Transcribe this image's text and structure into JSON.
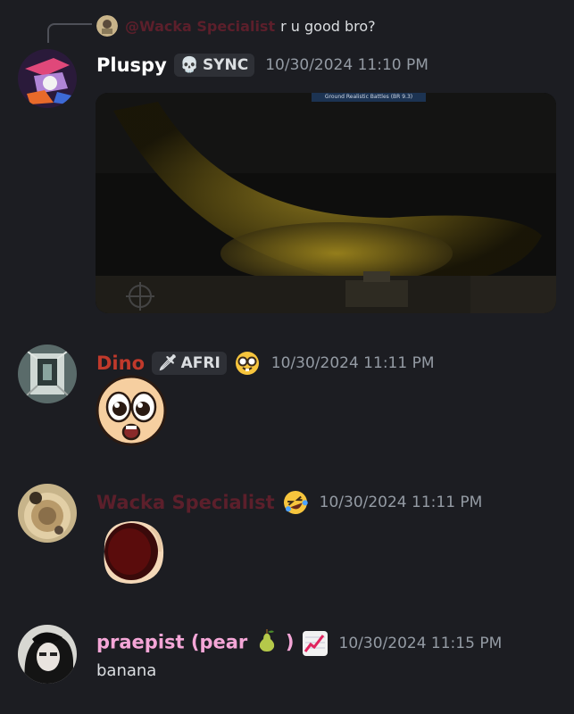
{
  "messages": [
    {
      "reply": {
        "author": "@Wacka Specialist",
        "text": "r u good bro?"
      },
      "author": "Pluspy",
      "tag": "SYNC",
      "timestamp": "10/30/2024 11:10 PM",
      "attachment": {
        "overlay_text": "Ground Realistic Battles (BR 9.3)"
      }
    },
    {
      "author": "Dino",
      "tag": "AFRI",
      "timestamp": "10/30/2024 11:11 PM"
    },
    {
      "author": "Wacka Specialist",
      "timestamp": "10/30/2024 11:11 PM"
    },
    {
      "author": "praepist (pear",
      "author_close": ")",
      "timestamp": "10/30/2024 11:15 PM",
      "text": "banana"
    }
  ],
  "colors": {
    "background": "#1c1d22",
    "pluspy": "#ffffff",
    "dino": "#c0392b",
    "wacka": "#5c1f2b",
    "praepist": "#f4a6d7",
    "timestamp": "#949ba4"
  }
}
